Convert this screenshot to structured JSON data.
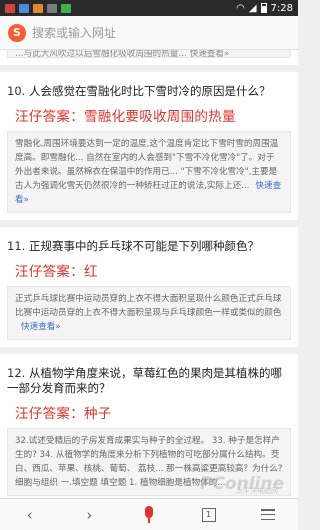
{
  "status_bar": {
    "time": "7:28"
  },
  "search": {
    "placeholder": "搜索或输入网址",
    "logo": "S"
  },
  "results": [
    {
      "cut_text": "…与此大风吹过以后雪融化吸收周围的热量… 快速查看»"
    },
    {
      "number": "10.",
      "question": "人会感觉在雪融化时比下雪时冷的原因是什么？",
      "answer": "汪仔答案：雪融化要吸收周围的热量",
      "snippet": "雪融化,周围环境要达到一定的温度,这个温度肯定比下雪时雪的周围温度高。即雪融化... 自然在室内的人会感到\"下雪不冷化雪冷\"了。对于外出者来说。虽然棉衣在保温中的作用已... \"下雪不冷化雪冷\",主要是古人为强调化雪天仍然很冷的一种矫枉过正的说法,实际上还...",
      "more": "快速查看»"
    },
    {
      "number": "11.",
      "question": "正规赛事中的乒乓球不可能是下列哪种颜色？",
      "answer": "汪仔答案：红",
      "snippet": "正式乒乓球比赛中运动员穿的上衣不得大面积呈现什么颜色正式乒乓球比赛中运动员穿的上衣不得大面积呈现与乒乓球颜色一样或类似的颜色",
      "more": "快速查看»"
    },
    {
      "number": "12.",
      "question": "从植物学角度来说，草莓红色的果肉是其植株的哪一部分发育而来的？",
      "answer": "汪仔答案：种子",
      "snippet": "32.试述受精后的子房发育成果实与种子的全过程。 33. 种子是怎样产生的? 34. 从植物学的角度来分析下列植物的可吃部分属什么结构。茭白、西瓜、苹果、核桃、葡萄、 荔枝... 那一株高粱更高较高？为什么?细胞与组织 一.填空题 填空题 1. 植物细胞是植物体的...",
      "more": ""
    }
  ],
  "bottom_bar": {
    "back": "‹",
    "forward": "›",
    "tab_count": "1"
  },
  "watermark": {
    "main": "PConline",
    "sub": "太平洋电脑网"
  }
}
